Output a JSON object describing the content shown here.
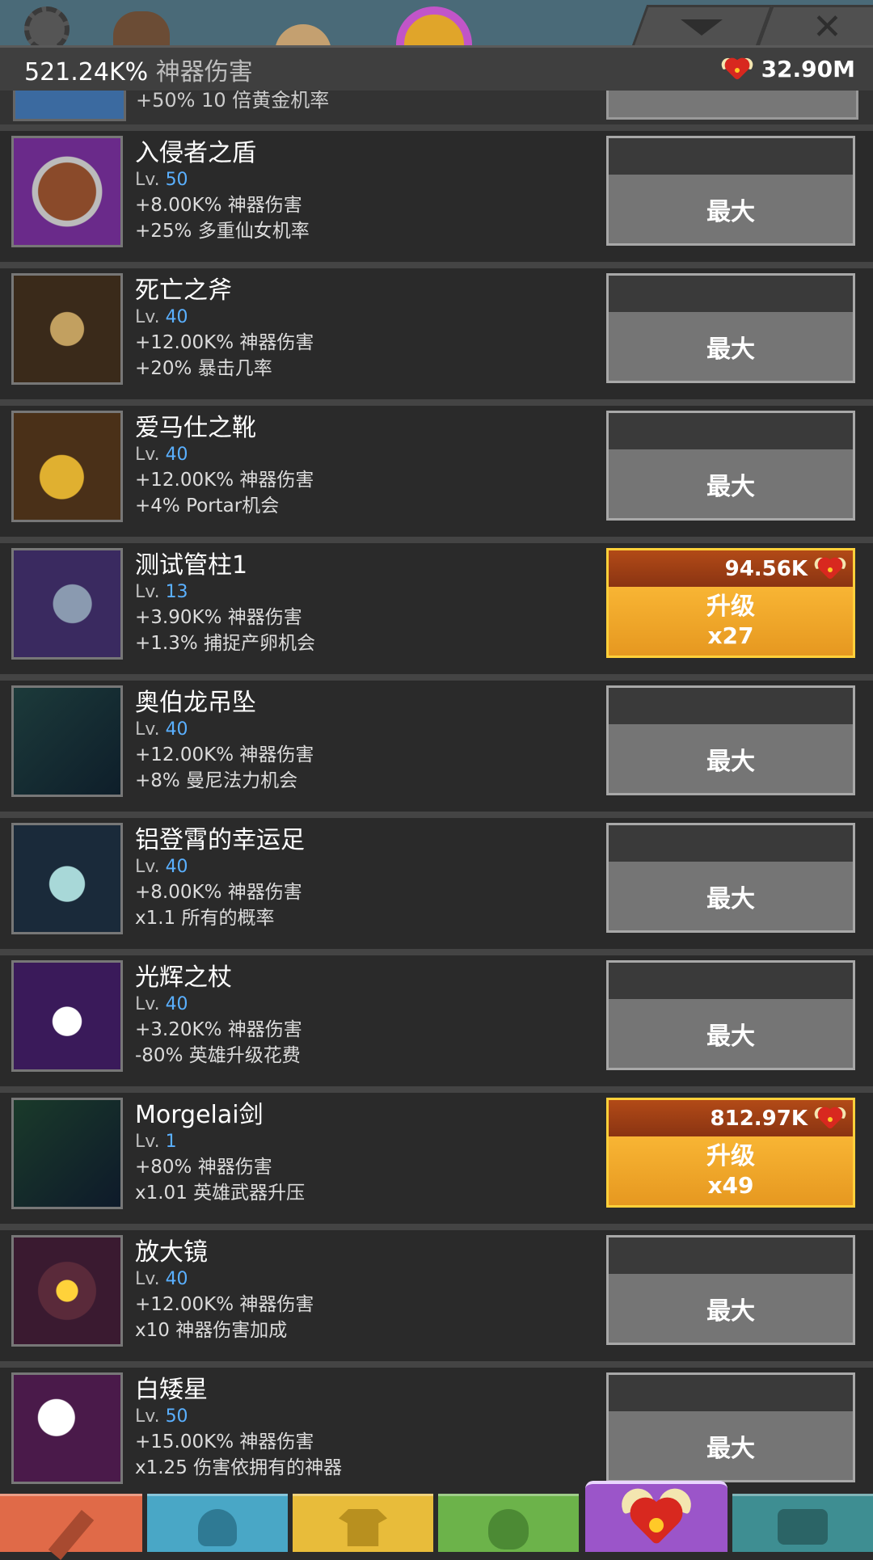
{
  "header": {
    "damage_value": "521.24K%",
    "damage_label": "神器伤害",
    "relics": "32.90M"
  },
  "partial_row": {
    "effect": "+50% 10 倍黄金机率"
  },
  "items": [
    {
      "name": "入侵者之盾",
      "lvl_prefix": "Lv.",
      "level": "50",
      "effect1": "+8.00K% 神器伤害",
      "effect2": "+25% 多重仙女机率",
      "button": "最大",
      "cost": "",
      "multiplier": "",
      "icon": "shield-icon",
      "thumb": "t-shield"
    },
    {
      "name": "死亡之斧",
      "lvl_prefix": "Lv.",
      "level": "40",
      "effect1": "+12.00K% 神器伤害",
      "effect2": "+20% 暴击几率",
      "button": "最大",
      "cost": "",
      "multiplier": "",
      "icon": "axe-icon",
      "thumb": "t-axe"
    },
    {
      "name": "爱马仕之靴",
      "lvl_prefix": "Lv.",
      "level": "40",
      "effect1": "+12.00K% 神器伤害",
      "effect2": "+4% Portar机会",
      "button": "最大",
      "cost": "",
      "multiplier": "",
      "icon": "boots-icon",
      "thumb": "t-boots"
    },
    {
      "name": "测试管柱1",
      "lvl_prefix": "Lv.",
      "level": "13",
      "effect1": "+3.90K% 神器伤害",
      "effect2": "+1.3% 捕捉产卵机会",
      "button": "升级",
      "cost": "94.56K",
      "multiplier": "x27",
      "icon": "gauntlet-icon",
      "thumb": "t-gaunt"
    },
    {
      "name": "奥伯龙吊坠",
      "lvl_prefix": "Lv.",
      "level": "40",
      "effect1": "+12.00K% 神器伤害",
      "effect2": "+8% 曼尼法力机会",
      "button": "最大",
      "cost": "",
      "multiplier": "",
      "icon": "pendant-icon",
      "thumb": "t-sword"
    },
    {
      "name": "铝登霄的幸运足",
      "lvl_prefix": "Lv.",
      "level": "40",
      "effect1": "+8.00K% 神器伤害",
      "effect2": "x1.1 所有的概率",
      "button": "最大",
      "cost": "",
      "multiplier": "",
      "icon": "lucky-foot-icon",
      "thumb": "t-foot"
    },
    {
      "name": "光辉之杖",
      "lvl_prefix": "Lv.",
      "level": "40",
      "effect1": "+3.20K% 神器伤害",
      "effect2": "-80% 英雄升级花费",
      "button": "最大",
      "cost": "",
      "multiplier": "",
      "icon": "staff-icon",
      "thumb": "t-staff"
    },
    {
      "name": "Morgelai剑",
      "lvl_prefix": "Lv.",
      "level": "1",
      "effect1": "+80% 神器伤害",
      "effect2": "x1.01 英雄武器升压",
      "button": "升级",
      "cost": "812.97K",
      "multiplier": "x49",
      "icon": "sword-icon",
      "thumb": "t-morg"
    },
    {
      "name": "放大镜",
      "lvl_prefix": "Lv.",
      "level": "40",
      "effect1": "+12.00K% 神器伤害",
      "effect2": "x10 神器伤害加成",
      "button": "最大",
      "cost": "",
      "multiplier": "",
      "icon": "magnifier-icon",
      "thumb": "t-glass"
    },
    {
      "name": "白矮星",
      "lvl_prefix": "Lv.",
      "level": "50",
      "effect1": "+15.00K% 神器伤害",
      "effect2": "x1.25 伤害依拥有的神器",
      "button": "最大",
      "cost": "",
      "multiplier": "",
      "icon": "hammer-icon",
      "thumb": "t-dwarf"
    }
  ],
  "tabs": [
    {
      "name": "tab-hero",
      "icon": "sword-icon"
    },
    {
      "name": "tab-heroes",
      "icon": "helmet-icon"
    },
    {
      "name": "tab-equipment",
      "icon": "shirt-icon"
    },
    {
      "name": "tab-pets",
      "icon": "pet-icon"
    },
    {
      "name": "tab-artifacts",
      "icon": "relic-icon",
      "active": true
    },
    {
      "name": "tab-shop",
      "icon": "chest-icon"
    }
  ],
  "colors": {
    "upgrade": "#f0a82a",
    "level": "#5ab0ff",
    "active_tab": "#9b55c9"
  }
}
